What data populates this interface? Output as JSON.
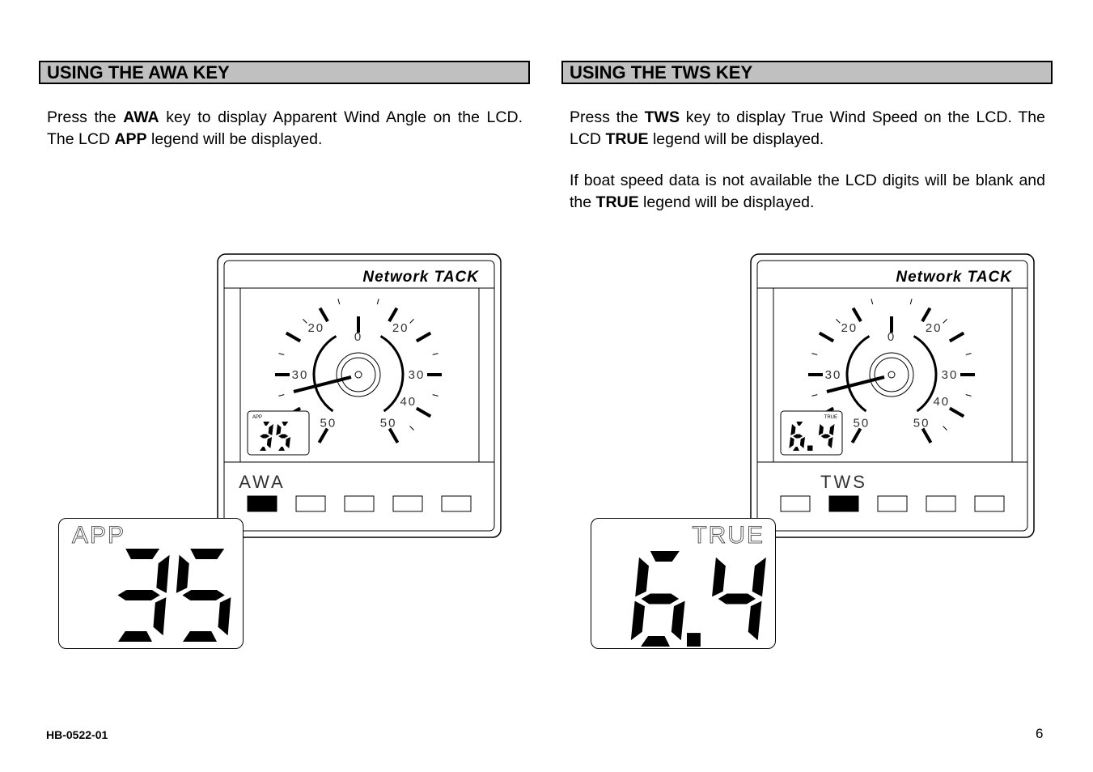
{
  "left_section": {
    "title": "USING THE AWA KEY",
    "para1": {
      "t1": "Press the ",
      "b1": "AWA",
      "t2": " key to display Apparent Wind Angle on the LCD. The LCD ",
      "b2": "APP",
      "t3": " legend will be displayed."
    },
    "device": {
      "brand": "Network TACK",
      "key_label": "AWA",
      "active_key_index": 0,
      "small_lcd_legend": "APP",
      "small_lcd_value": "35",
      "scale_labels": [
        "0",
        "20",
        "20",
        "30",
        "30",
        "40",
        "50",
        "50"
      ]
    },
    "big_lcd": {
      "legend": "APP",
      "value": "35"
    }
  },
  "right_section": {
    "title": "USING THE TWS KEY",
    "para1": {
      "t1": "Press the ",
      "b1": "TWS",
      "t2": " key to display True Wind Speed on the LCD. The LCD ",
      "b2": "TRUE",
      "t3": " legend will be displayed."
    },
    "para2": {
      "t1": "If boat speed data is not available the LCD digits will be blank and the ",
      "b1": "TRUE",
      "t2": " legend will be displayed."
    },
    "device": {
      "brand": "Network TACK",
      "key_label": "TWS",
      "active_key_index": 1,
      "small_lcd_legend": "TRUE",
      "small_lcd_value": "6.4",
      "scale_labels": [
        "0",
        "20",
        "20",
        "30",
        "30",
        "40",
        "50",
        "50"
      ]
    },
    "big_lcd": {
      "legend": "TRUE",
      "value": "6.4"
    }
  },
  "footer": {
    "doc_code": "HB-0522-01",
    "page_number": "6"
  }
}
